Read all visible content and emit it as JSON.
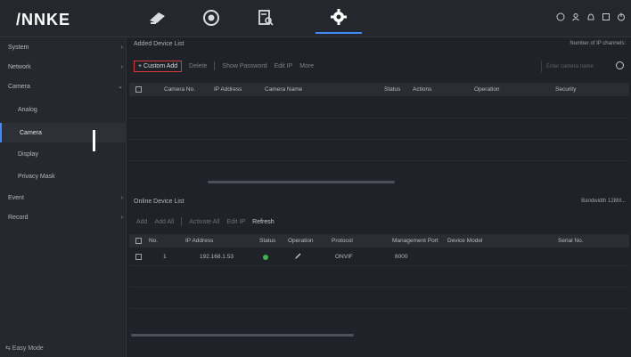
{
  "header": {
    "logo": "/NNKE",
    "nav": [
      {
        "icon": "camera-live-icon"
      },
      {
        "icon": "playback-icon"
      },
      {
        "icon": "search-file-icon"
      },
      {
        "icon": "settings-gear-icon",
        "active": true
      }
    ],
    "right_icons": [
      "info-icon",
      "user-icon",
      "alarm-icon",
      "fullscreen-icon",
      "power-icon"
    ]
  },
  "sidebar": {
    "items": [
      {
        "label": "System",
        "chevron": "›"
      },
      {
        "label": "Network",
        "chevron": "›"
      },
      {
        "label": "Camera",
        "chevron": "⌄"
      },
      {
        "label": "Analog",
        "chevron": ""
      },
      {
        "label": "Camera",
        "chevron": ""
      },
      {
        "label": "Display",
        "chevron": ""
      },
      {
        "label": "Privacy Mask",
        "chevron": ""
      },
      {
        "label": "Event",
        "chevron": "›"
      },
      {
        "label": "Record",
        "chevron": "›"
      }
    ],
    "easy_mode": "⇆ Easy Mode"
  },
  "main": {
    "added_title": "Added Device List",
    "summary_prefix": "Number of IP channels:",
    "summary_accent": "",
    "toolbar": {
      "custom_add": "+ Custom Add",
      "delete": "Delete",
      "show_password": "Show Password",
      "edit_ip": "Edit IP",
      "more": "More"
    },
    "search_placeholder": "Enter camera name",
    "added_columns": [
      "",
      "Camera No.",
      "IP Address",
      "Camera Name",
      "Status",
      "Actions",
      "Operation",
      "Security"
    ],
    "online_title": "Online Device List",
    "online_right": "Bandwidth 128M...",
    "toolbar2": {
      "add": "Add",
      "add_all": "Add All",
      "activate_all": "Activate All",
      "edit_ip": "Edit IP",
      "refresh": "Refresh"
    },
    "online_columns": [
      "",
      "No.",
      "IP Address",
      "Status",
      "Operation",
      "Protocol",
      "Management Port",
      "Device Model",
      "Serial No."
    ],
    "online_rows": [
      {
        "no": "1",
        "ip": "192.168.1.53",
        "status": "online",
        "operation": "edit",
        "protocol": "ONVIF",
        "port": "8000",
        "model": "",
        "serial": ""
      }
    ]
  }
}
